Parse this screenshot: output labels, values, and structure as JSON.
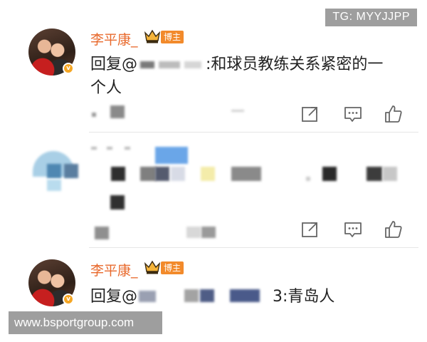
{
  "watermark": {
    "top_text": "TG: MYYJJPP",
    "bottom_text": "www.bsportgroup.com"
  },
  "comments": [
    {
      "username": "李平康_",
      "badge_label": "博主",
      "verified_icon": "v-badge-icon",
      "reply_prefix": "回复@",
      "text_after_mention": ":和球员教练关系紧密的一",
      "text_line2": "个人",
      "actions": [
        "share-icon",
        "comment-icon",
        "like-icon"
      ]
    },
    {
      "username": "",
      "redacted": true,
      "actions": [
        "share-icon",
        "comment-icon",
        "like-icon"
      ]
    },
    {
      "username": "李平康_",
      "badge_label": "博主",
      "verified_icon": "v-badge-icon",
      "reply_prefix": "回复@",
      "text_tail": "3:青岛人"
    }
  ],
  "colors": {
    "username": "#e8692c",
    "badge": "#f28a2b",
    "watermark_bg": "#9e9e9e"
  }
}
